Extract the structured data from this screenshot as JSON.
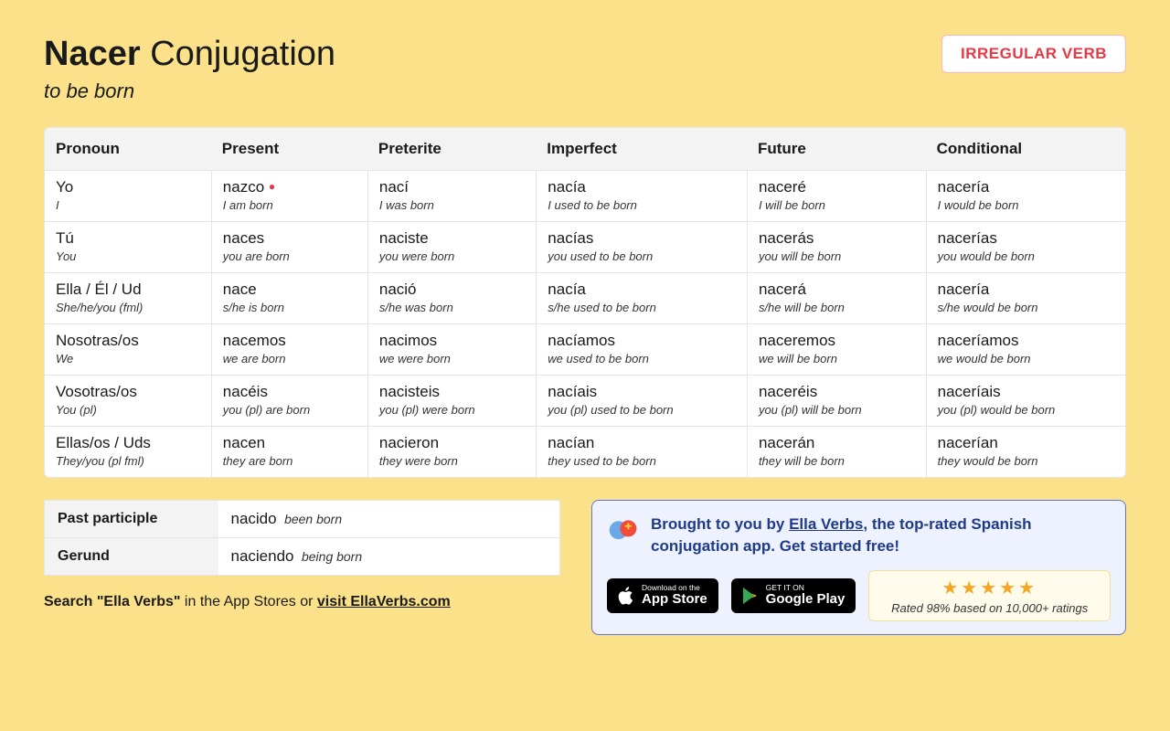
{
  "header": {
    "verb": "Nacer",
    "title_rest": "Conjugation",
    "translation": "to be born",
    "badge": "IRREGULAR VERB"
  },
  "columns": [
    "Pronoun",
    "Present",
    "Preterite",
    "Imperfect",
    "Future",
    "Conditional"
  ],
  "rows": [
    {
      "pron": "Yo",
      "pron_tr": "I",
      "cells": [
        {
          "form": "nazco",
          "irregular": true,
          "tr": "I am born"
        },
        {
          "form": "nací",
          "tr": "I was born"
        },
        {
          "form": "nacía",
          "tr": "I used to be born"
        },
        {
          "form": "naceré",
          "tr": "I will be born"
        },
        {
          "form": "nacería",
          "tr": "I would be born"
        }
      ]
    },
    {
      "pron": "Tú",
      "pron_tr": "You",
      "cells": [
        {
          "form": "naces",
          "tr": "you are born"
        },
        {
          "form": "naciste",
          "tr": "you were born"
        },
        {
          "form": "nacías",
          "tr": "you used to be born"
        },
        {
          "form": "nacerás",
          "tr": "you will be born"
        },
        {
          "form": "nacerías",
          "tr": "you would be born"
        }
      ]
    },
    {
      "pron": "Ella / Él / Ud",
      "pron_tr": "She/he/you (fml)",
      "cells": [
        {
          "form": "nace",
          "tr": "s/he is born"
        },
        {
          "form": "nació",
          "tr": "s/he was born"
        },
        {
          "form": "nacía",
          "tr": "s/he used to be born"
        },
        {
          "form": "nacerá",
          "tr": "s/he will be born"
        },
        {
          "form": "nacería",
          "tr": "s/he would be born"
        }
      ]
    },
    {
      "pron": "Nosotras/os",
      "pron_tr": "We",
      "cells": [
        {
          "form": "nacemos",
          "tr": "we are born"
        },
        {
          "form": "nacimos",
          "tr": "we were born"
        },
        {
          "form": "nacíamos",
          "tr": "we used to be born"
        },
        {
          "form": "naceremos",
          "tr": "we will be born"
        },
        {
          "form": "naceríamos",
          "tr": "we would be born"
        }
      ]
    },
    {
      "pron": "Vosotras/os",
      "pron_tr": "You (pl)",
      "cells": [
        {
          "form": "nacéis",
          "tr": "you (pl) are born"
        },
        {
          "form": "nacisteis",
          "tr": "you (pl) were born"
        },
        {
          "form": "nacíais",
          "tr": "you (pl) used to be born"
        },
        {
          "form": "naceréis",
          "tr": "you (pl) will be born"
        },
        {
          "form": "naceríais",
          "tr": "you (pl) would be born"
        }
      ]
    },
    {
      "pron": "Ellas/os / Uds",
      "pron_tr": "They/you (pl fml)",
      "cells": [
        {
          "form": "nacen",
          "tr": "they are born"
        },
        {
          "form": "nacieron",
          "tr": "they were born"
        },
        {
          "form": "nacían",
          "tr": "they used to be born"
        },
        {
          "form": "nacerán",
          "tr": "they will be born"
        },
        {
          "form": "nacerían",
          "tr": "they would be born"
        }
      ]
    }
  ],
  "parts": [
    {
      "label": "Past participle",
      "val": "nacido",
      "tr": "been born"
    },
    {
      "label": "Gerund",
      "val": "naciendo",
      "tr": "being born"
    }
  ],
  "search_line": {
    "strong": "Search \"Ella Verbs\"",
    "rest": " in the App Stores or ",
    "link": "visit EllaVerbs.com"
  },
  "promo": {
    "text_before": "Brought to you by ",
    "brand": "Ella Verbs",
    "text_after": ", the top-rated Spanish conjugation app. Get started free!",
    "appstore": {
      "small": "Download on the",
      "big": "App Store"
    },
    "play": {
      "small": "GET IT ON",
      "big": "Google Play"
    },
    "rating": "Rated 98% based on 10,000+ ratings"
  }
}
